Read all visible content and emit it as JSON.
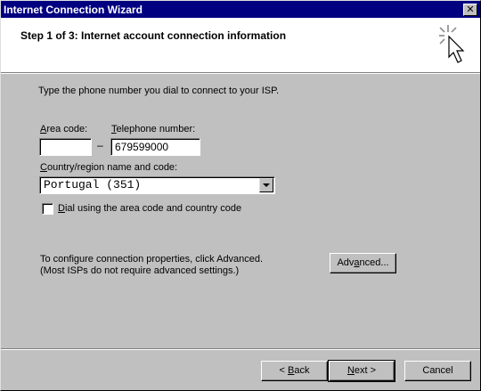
{
  "window": {
    "title": "Internet Connection Wizard",
    "close_glyph": "✕",
    "header_icon": "wizard-wand-cursor-icon"
  },
  "header": {
    "step_title": "Step 1 of 3: Internet account connection information"
  },
  "form": {
    "instruction": "Type the phone number you dial to connect to your ISP.",
    "area_code": {
      "mnemonic": "A",
      "label_rest": "rea code:",
      "value": ""
    },
    "separator": "–",
    "telephone": {
      "mnemonic": "T",
      "label_rest": "elephone number:",
      "value": "679599000"
    },
    "country": {
      "mnemonic": "C",
      "label_rest": "ountry/region name and code:",
      "selected": "Portugal (351)"
    },
    "dial_checkbox": {
      "mnemonic": "D",
      "label_rest": "ial using the area code and country code",
      "checked": false
    },
    "advanced_info_line1": "To configure connection properties, click Advanced.",
    "advanced_info_line2": "(Most ISPs do not require advanced settings.)",
    "advanced_button": {
      "prefix": "Adv",
      "mnemonic": "a",
      "rest": "nced..."
    }
  },
  "footer": {
    "back": {
      "prefix": "< ",
      "mnemonic": "B",
      "rest": "ack"
    },
    "next": {
      "mnemonic": "N",
      "rest": "ext >"
    },
    "cancel": "Cancel"
  }
}
